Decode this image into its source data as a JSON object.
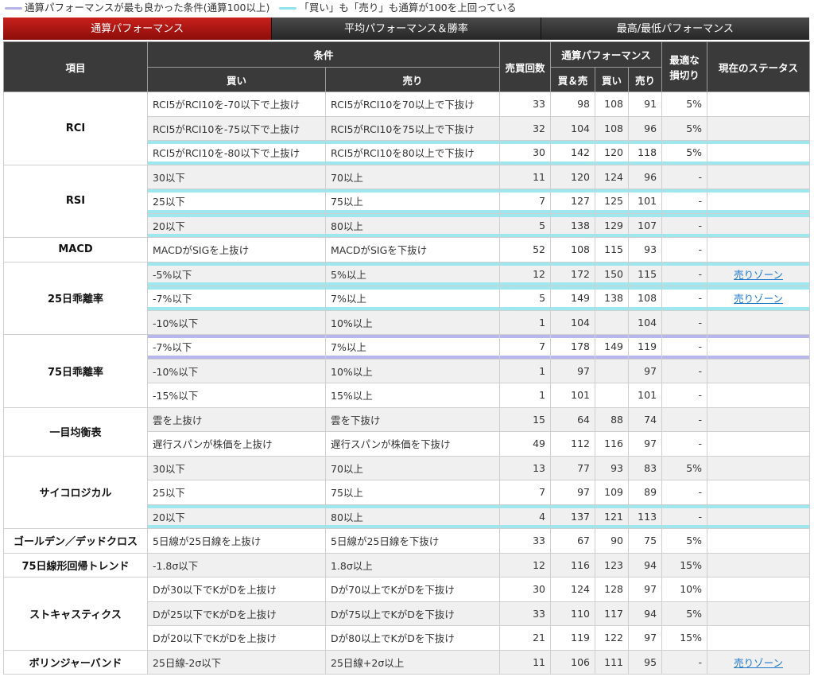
{
  "legend": {
    "item1": "通算パフォーマンスが最も良かった条件(通算100以上)",
    "item2": "「買い」も「売り」も通算が100を上回っている",
    "colors": {
      "purple": "#b3b3ea",
      "cyan": "#8fe3ea"
    }
  },
  "tabs": [
    {
      "label": "通算パフォーマンス",
      "active": true
    },
    {
      "label": "平均パフォーマンス＆勝率",
      "active": false
    },
    {
      "label": "最高/最低パフォーマンス",
      "active": false
    }
  ],
  "headers": {
    "item": "項目",
    "condition": "条件",
    "buy": "買い",
    "sell": "売り",
    "count": "売買回数",
    "perf": "通算パフォーマンス",
    "both": "買＆売",
    "buy2": "買い",
    "sell2": "売り",
    "stop_l1": "最適な",
    "stop_l2": "損切り",
    "status": "現在のステータス"
  },
  "groups": [
    {
      "name": "RCI",
      "rows": [
        {
          "buy": "RCI5がRCI10を-70以下で上抜け",
          "sell": "RCI5がRCI10を70以上で下抜け",
          "count": "33",
          "both": "98",
          "b": "108",
          "s": "91",
          "stop": "5%",
          "status": "",
          "hl": ""
        },
        {
          "buy": "RCI5がRCI10を-75以下で上抜け",
          "sell": "RCI5がRCI10を75以上で下抜け",
          "count": "32",
          "both": "104",
          "b": "108",
          "s": "96",
          "stop": "5%",
          "status": "",
          "hl": ""
        },
        {
          "buy": "RCI5がRCI10を-80以下で上抜け",
          "sell": "RCI5がRCI10を80以上で下抜け",
          "count": "30",
          "both": "142",
          "b": "120",
          "s": "118",
          "stop": "5%",
          "status": "",
          "hl": "cyan"
        }
      ]
    },
    {
      "name": "RSI",
      "rows": [
        {
          "buy": "30以下",
          "sell": "70以上",
          "count": "11",
          "both": "120",
          "b": "124",
          "s": "96",
          "stop": "-",
          "status": "",
          "hl": ""
        },
        {
          "buy": "25以下",
          "sell": "75以上",
          "count": "7",
          "both": "127",
          "b": "125",
          "s": "101",
          "stop": "-",
          "status": "",
          "hl": "cyan"
        },
        {
          "buy": "20以下",
          "sell": "80以上",
          "count": "5",
          "both": "138",
          "b": "129",
          "s": "107",
          "stop": "-",
          "status": "",
          "hl": "cyan"
        }
      ]
    },
    {
      "name": "MACD",
      "rows": [
        {
          "buy": "MACDがSIGを上抜け",
          "sell": "MACDがSIGを下抜け",
          "count": "52",
          "both": "108",
          "b": "115",
          "s": "93",
          "stop": "-",
          "status": "",
          "hl": ""
        }
      ]
    },
    {
      "name": "25日乖離率",
      "rows": [
        {
          "buy": "-5%以下",
          "sell": "5%以上",
          "count": "12",
          "both": "172",
          "b": "150",
          "s": "115",
          "stop": "-",
          "status": "売りゾーン",
          "hl": "cyan"
        },
        {
          "buy": "-7%以下",
          "sell": "7%以上",
          "count": "5",
          "both": "149",
          "b": "138",
          "s": "108",
          "stop": "-",
          "status": "売りゾーン",
          "hl": "cyan"
        },
        {
          "buy": "-10%以下",
          "sell": "10%以上",
          "count": "1",
          "both": "104",
          "b": "",
          "s": "104",
          "stop": "-",
          "status": "",
          "hl": ""
        }
      ]
    },
    {
      "name": "75日乖離率",
      "rows": [
        {
          "buy": "-7%以下",
          "sell": "7%以上",
          "count": "7",
          "both": "178",
          "b": "149",
          "s": "119",
          "stop": "-",
          "status": "",
          "hl": "purple"
        },
        {
          "buy": "-10%以下",
          "sell": "10%以上",
          "count": "1",
          "both": "97",
          "b": "",
          "s": "97",
          "stop": "-",
          "status": "",
          "hl": ""
        },
        {
          "buy": "-15%以下",
          "sell": "15%以上",
          "count": "1",
          "both": "101",
          "b": "",
          "s": "101",
          "stop": "-",
          "status": "",
          "hl": ""
        }
      ]
    },
    {
      "name": "一目均衡表",
      "rows": [
        {
          "buy": "雲を上抜け",
          "sell": "雲を下抜け",
          "count": "15",
          "both": "64",
          "b": "88",
          "s": "74",
          "stop": "-",
          "status": "",
          "hl": ""
        },
        {
          "buy": "遅行スパンが株価を上抜け",
          "sell": "遅行スパンが株価を下抜け",
          "count": "49",
          "both": "112",
          "b": "116",
          "s": "97",
          "stop": "-",
          "status": "",
          "hl": ""
        }
      ]
    },
    {
      "name": "サイコロジカル",
      "rows": [
        {
          "buy": "30以下",
          "sell": "70以上",
          "count": "13",
          "both": "77",
          "b": "93",
          "s": "83",
          "stop": "5%",
          "status": "",
          "hl": ""
        },
        {
          "buy": "25以下",
          "sell": "75以上",
          "count": "7",
          "both": "97",
          "b": "109",
          "s": "89",
          "stop": "-",
          "status": "",
          "hl": ""
        },
        {
          "buy": "20以下",
          "sell": "80以上",
          "count": "4",
          "both": "137",
          "b": "121",
          "s": "113",
          "stop": "-",
          "status": "",
          "hl": "cyan"
        }
      ]
    },
    {
      "name": "ゴールデン／デッドクロス",
      "rows": [
        {
          "buy": "5日線が25日線を上抜け",
          "sell": "5日線が25日線を下抜け",
          "count": "33",
          "both": "67",
          "b": "90",
          "s": "75",
          "stop": "5%",
          "status": "",
          "hl": ""
        }
      ]
    },
    {
      "name": "75日線形回帰トレンド",
      "rows": [
        {
          "buy": "-1.8σ以下",
          "sell": "1.8σ以上",
          "count": "12",
          "both": "116",
          "b": "123",
          "s": "94",
          "stop": "15%",
          "status": "",
          "hl": ""
        }
      ]
    },
    {
      "name": "ストキャスティクス",
      "rows": [
        {
          "buy": "Dが30以下でKがDを上抜け",
          "sell": "Dが70以上でKがDを下抜け",
          "count": "30",
          "both": "124",
          "b": "128",
          "s": "97",
          "stop": "10%",
          "status": "",
          "hl": ""
        },
        {
          "buy": "Dが25以下でKがDを上抜け",
          "sell": "Dが75以上でKがDを下抜け",
          "count": "33",
          "both": "110",
          "b": "117",
          "s": "94",
          "stop": "5%",
          "status": "",
          "hl": ""
        },
        {
          "buy": "Dが20以下でKがDを上抜け",
          "sell": "Dが80以上でKがDを下抜け",
          "count": "21",
          "both": "119",
          "b": "122",
          "s": "97",
          "stop": "15%",
          "status": "",
          "hl": ""
        }
      ]
    },
    {
      "name": "ボリンジャーバンド",
      "rows": [
        {
          "buy": "25日線-2σ以下",
          "sell": "25日線+2σ以上",
          "count": "11",
          "both": "106",
          "b": "111",
          "s": "95",
          "stop": "-",
          "status": "売りゾーン",
          "hl": ""
        }
      ]
    }
  ]
}
